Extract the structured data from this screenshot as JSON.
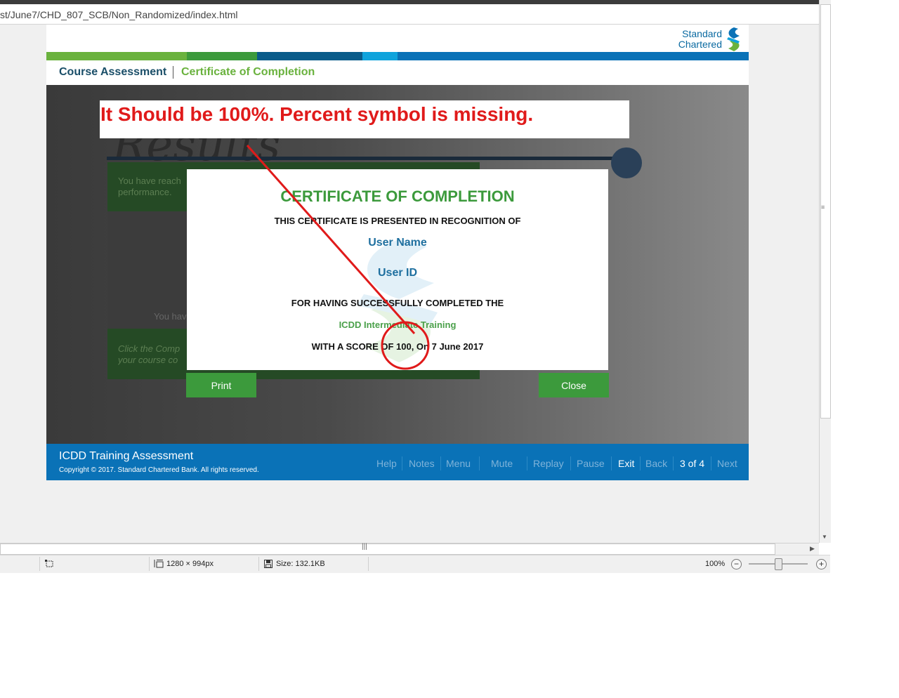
{
  "browser": {
    "url": "st/June7/CHD_807_SCB/Non_Randomized/index.html"
  },
  "course": {
    "logo": {
      "line1": "Standard",
      "line2": "Chartered"
    },
    "stripe_colors": [
      "#6ab23e",
      "#3c9a3c",
      "#0a5c8a",
      "#0fa3dc",
      "#0a72b7"
    ],
    "breadcrumb": {
      "course": "Course Assessment",
      "current": "Certificate of Completion"
    },
    "background": {
      "heading": "Results",
      "panel_text1": "You have reach\nperformance.",
      "panel_text2": "You hav",
      "panel_text3": "Click the Comp\nyour course co"
    }
  },
  "certificate": {
    "title": "CERTIFICATE OF COMPLETION",
    "presented": "THIS CERTIFICATE IS PRESENTED IN RECOGNITION OF",
    "user_name": "User Name",
    "user_id": "User ID",
    "completed": "FOR HAVING SUCCESSFULLY COMPLETED THE",
    "course_name": "ICDD Intermediate Training",
    "score_line": "WITH A SCORE OF 100, On 7 June 2017"
  },
  "buttons": {
    "print": "Print",
    "close": "Close"
  },
  "annotation": {
    "text": "It Should be 100%. Percent symbol is missing.",
    "color": "#e01a1a"
  },
  "footer": {
    "title": "ICDD Training Assessment",
    "copyright": "Copyright © 2017. Standard Chartered Bank. All rights reserved.",
    "nav": {
      "help": "Help",
      "notes": "Notes",
      "menu": "Menu",
      "mute": "Mute",
      "replay": "Replay",
      "pause": "Pause",
      "exit": "Exit",
      "back": "Back",
      "page": "3 of 4",
      "next": "Next"
    }
  },
  "statusbar": {
    "dimensions": "1280 × 994px",
    "size": "Size: 132.1KB",
    "zoom": "100%",
    "zoom_out": "−",
    "zoom_in": "+"
  },
  "icons": [
    "select-region-icon",
    "dimensions-icon",
    "save-disk-icon",
    "zoom-out-icon",
    "zoom-in-icon"
  ]
}
